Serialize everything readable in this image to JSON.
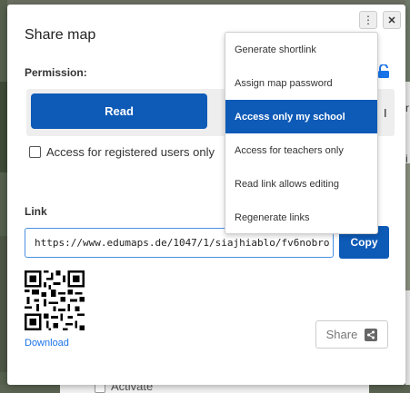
{
  "modal": {
    "title": "Share map",
    "permission_label": "Permission:",
    "permissions": [
      {
        "label": "Read",
        "selected": true
      }
    ],
    "permission_peek_text": "I",
    "registered_only": {
      "label": "Access for registered users only",
      "checked": false
    },
    "link_label": "Link",
    "link_value": "https://www.edumaps.de/1047/1/siajhiablo/fv6nobro",
    "copy_label": "Copy",
    "download_label": "Download",
    "share_label": "Share"
  },
  "menu": {
    "items": [
      {
        "label": "Generate shortlink",
        "active": false
      },
      {
        "label": "Assign map password",
        "active": false
      },
      {
        "label": "Access only my school",
        "active": true
      },
      {
        "label": "Access for teachers only",
        "active": false
      },
      {
        "label": "Read link allows editing",
        "active": false
      },
      {
        "label": "Regenerate links",
        "active": false
      }
    ]
  },
  "background": {
    "activate_label": "Activate",
    "peek_texts": [
      "r",
      "i"
    ]
  },
  "icons": {
    "more": "more-vertical-icon",
    "close": "close-icon",
    "lock": "unlock-icon",
    "share": "share-icon"
  },
  "colors": {
    "primary": "#0d5ab7",
    "link": "#1a73e8",
    "lock": "#1a73e8"
  }
}
